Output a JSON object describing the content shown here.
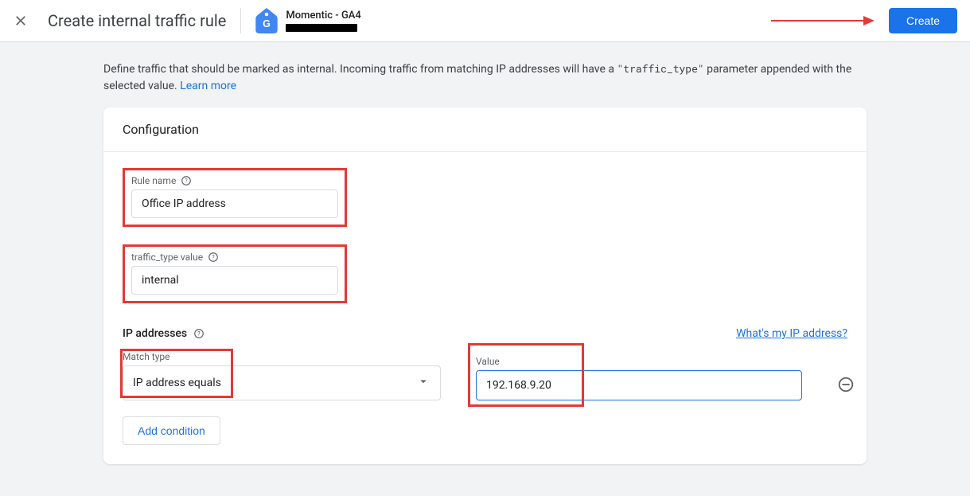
{
  "header": {
    "title": "Create internal traffic rule",
    "brand": "Momentic - GA4",
    "createBtn": "Create"
  },
  "description": {
    "text_a": "Define traffic that should be marked as internal. Incoming traffic from matching IP addresses will have a ",
    "code": "\"traffic_type\"",
    "text_b": " parameter appended with the selected value. ",
    "learn": "Learn more"
  },
  "card": {
    "heading": "Configuration",
    "rule_name_label": "Rule name",
    "rule_name_value": "Office IP address",
    "traffic_type_label": "traffic_type value",
    "traffic_type_value": "internal",
    "ip_section": "IP addresses",
    "whats_my_ip": "What's my IP address?",
    "match_label": "Match type",
    "match_value": "IP address equals",
    "value_label": "Value",
    "value_value": "192.168.9.20",
    "add_condition": "Add condition"
  }
}
